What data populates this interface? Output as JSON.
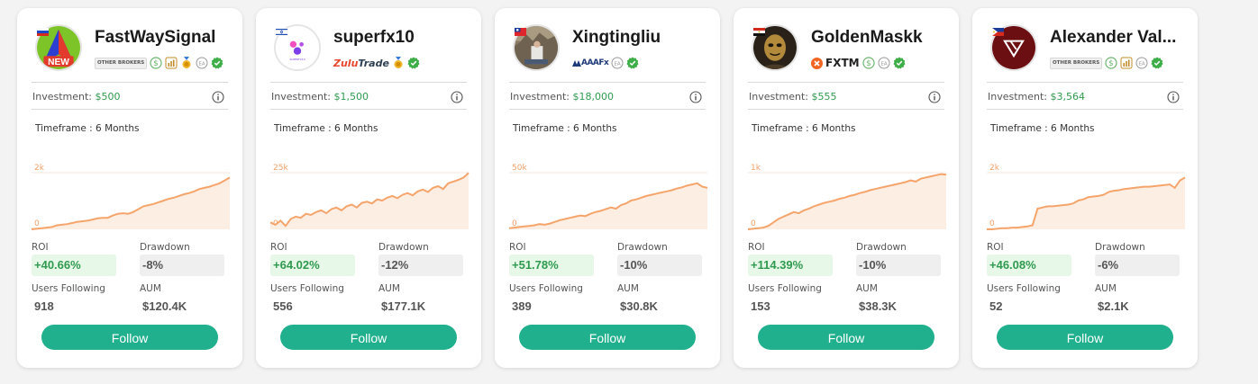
{
  "labels": {
    "investment": "Investment:",
    "timeframe": "Timeframe : 6 Months",
    "roi": "ROI",
    "drawdown": "Drawdown",
    "users_following": "Users Following",
    "aum": "AUM",
    "follow": "Follow",
    "other_brokers": "OTHER BROKERS"
  },
  "colors": {
    "accent": "#20b08e",
    "positive": "#2f9a4f",
    "chart_line": "#f5a46b",
    "chart_fill": "#fdeee3"
  },
  "cards": [
    {
      "name": "FastWaySignal",
      "flag": "russia-flag",
      "avatar": "new-arrow-logo",
      "avatar_text": "NEW",
      "broker": "OTHER BROKERS",
      "badges": [
        "dollar-icon",
        "chart-icon",
        "medal-icon",
        "ea-icon",
        "verified-icon"
      ],
      "investment": "$500",
      "roi": "+40.66%",
      "drawdown": "-8%",
      "users_following": "918",
      "aum": "$120.4K",
      "chart_data": {
        "type": "area",
        "y_ticks": [
          "2k",
          "0"
        ],
        "values": [
          0.0,
          0.01,
          0.02,
          0.03,
          0.04,
          0.07,
          0.08,
          0.09,
          0.11,
          0.13,
          0.14,
          0.15,
          0.17,
          0.19,
          0.2,
          0.2,
          0.24,
          0.27,
          0.28,
          0.27,
          0.3,
          0.35,
          0.4,
          0.42,
          0.44,
          0.47,
          0.5,
          0.53,
          0.55,
          0.58,
          0.61,
          0.63,
          0.66,
          0.7,
          0.72,
          0.74,
          0.77,
          0.8,
          0.85,
          0.9
        ]
      }
    },
    {
      "name": "superfx10",
      "flag": "israel-flag",
      "avatar": "superfx-logo",
      "avatar_text": "SUPERFX10",
      "broker": "ZuluTrade",
      "badges": [
        "medal-icon",
        "verified-icon"
      ],
      "investment": "$1,500",
      "roi": "+64.02%",
      "drawdown": "-12%",
      "users_following": "556",
      "aum": "$177.1K",
      "chart_data": {
        "type": "area",
        "y_ticks": [
          "25k",
          "0"
        ],
        "values": [
          0.12,
          0.08,
          0.15,
          0.06,
          0.18,
          0.22,
          0.2,
          0.27,
          0.25,
          0.3,
          0.33,
          0.28,
          0.35,
          0.38,
          0.33,
          0.4,
          0.43,
          0.38,
          0.46,
          0.48,
          0.45,
          0.52,
          0.5,
          0.55,
          0.58,
          0.54,
          0.6,
          0.63,
          0.59,
          0.66,
          0.69,
          0.65,
          0.72,
          0.75,
          0.7,
          0.8,
          0.83,
          0.86,
          0.9,
          0.98
        ]
      }
    },
    {
      "name": "Xingtingliu",
      "flag": "taiwan-flag",
      "avatar": "photo-avatar",
      "avatar_text": "",
      "broker": "AAAFx",
      "badges": [
        "ea-icon",
        "verified-icon"
      ],
      "investment": "$18,000",
      "roi": "+51.78%",
      "drawdown": "-10%",
      "users_following": "389",
      "aum": "$30.8K",
      "chart_data": {
        "type": "area",
        "y_ticks": [
          "50k",
          "0"
        ],
        "values": [
          0.02,
          0.03,
          0.04,
          0.05,
          0.06,
          0.07,
          0.09,
          0.08,
          0.1,
          0.13,
          0.16,
          0.18,
          0.2,
          0.22,
          0.24,
          0.23,
          0.27,
          0.3,
          0.32,
          0.35,
          0.38,
          0.36,
          0.42,
          0.45,
          0.5,
          0.52,
          0.55,
          0.58,
          0.6,
          0.62,
          0.64,
          0.66,
          0.68,
          0.71,
          0.73,
          0.76,
          0.78,
          0.8,
          0.74,
          0.72
        ]
      }
    },
    {
      "name": "GoldenMaskk",
      "flag": "egypt-flag",
      "avatar": "mask-avatar",
      "avatar_text": "",
      "broker": "FXTM",
      "badges": [
        "dollar-icon",
        "ea-icon",
        "verified-icon"
      ],
      "investment": "$555",
      "roi": "+114.39%",
      "drawdown": "-10%",
      "users_following": "153",
      "aum": "$38.3K",
      "chart_data": {
        "type": "area",
        "y_ticks": [
          "1k",
          "0"
        ],
        "values": [
          0.0,
          0.01,
          0.02,
          0.03,
          0.06,
          0.12,
          0.18,
          0.22,
          0.26,
          0.3,
          0.28,
          0.33,
          0.36,
          0.4,
          0.43,
          0.46,
          0.48,
          0.5,
          0.53,
          0.55,
          0.58,
          0.6,
          0.63,
          0.65,
          0.68,
          0.7,
          0.72,
          0.74,
          0.76,
          0.78,
          0.8,
          0.82,
          0.85,
          0.83,
          0.88,
          0.9,
          0.92,
          0.94,
          0.96,
          0.95
        ]
      }
    },
    {
      "name": "Alexander Val...",
      "flag": "philippines-flag",
      "avatar": "v-logo",
      "avatar_text": "",
      "broker": "OTHER BROKERS",
      "badges": [
        "dollar-icon",
        "chart-icon",
        "ea-icon",
        "verified-icon"
      ],
      "investment": "$3,564",
      "roi": "+46.08%",
      "drawdown": "-6%",
      "users_following": "52",
      "aum": "$2.1K",
      "chart_data": {
        "type": "area",
        "y_ticks": [
          "2k",
          "0"
        ],
        "values": [
          0.0,
          0.0,
          0.01,
          0.02,
          0.02,
          0.03,
          0.03,
          0.04,
          0.05,
          0.07,
          0.36,
          0.38,
          0.4,
          0.4,
          0.41,
          0.42,
          0.43,
          0.45,
          0.5,
          0.52,
          0.56,
          0.57,
          0.58,
          0.6,
          0.65,
          0.67,
          0.68,
          0.7,
          0.71,
          0.72,
          0.73,
          0.74,
          0.74,
          0.75,
          0.76,
          0.77,
          0.78,
          0.72,
          0.85,
          0.9
        ]
      }
    }
  ]
}
